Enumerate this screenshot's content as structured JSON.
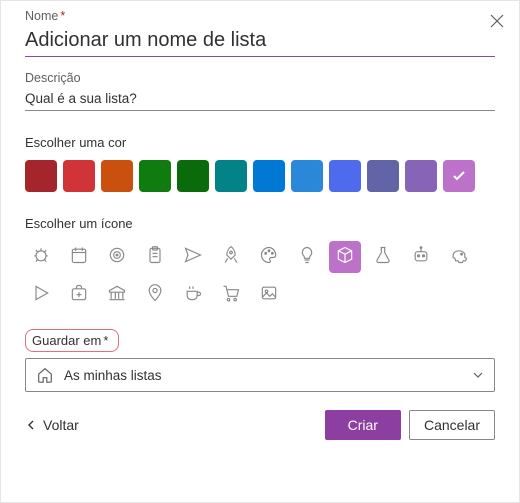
{
  "name_field": {
    "label": "Nome",
    "required_marker": "*",
    "value": "Adicionar um nome de lista"
  },
  "description_field": {
    "label": "Descrição",
    "value": "Qual é a sua lista?"
  },
  "color_section": {
    "label": "Escolher uma cor",
    "colors": [
      "#a4262c",
      "#d13438",
      "#ca5010",
      "#107c10",
      "#0b6a0b",
      "#038387",
      "#0078d4",
      "#2b88d8",
      "#4f6bed",
      "#6264a7",
      "#8764b8",
      "#bc72c9"
    ],
    "selected_index": 11
  },
  "icon_section": {
    "label": "Escolher um ícone",
    "icons_row1": [
      "bug-icon",
      "calendar-icon",
      "target-icon",
      "clipboard-icon",
      "airplane-icon",
      "rocket-icon",
      "palette-icon",
      "lightbulb-icon",
      "cube-icon",
      "flask-icon",
      "robot-icon",
      "piggybank-icon"
    ],
    "icons_row2": [
      "play-icon",
      "firstaid-icon",
      "bank-icon",
      "mappin-icon",
      "coffee-icon",
      "cart-icon",
      "image-icon"
    ],
    "selected": "cube-icon"
  },
  "save_to": {
    "label": "Guardar em",
    "marker": "*",
    "dropdown_value": "As minhas listas"
  },
  "footer": {
    "back": "Voltar",
    "create": "Criar",
    "cancel": "Cancelar"
  }
}
